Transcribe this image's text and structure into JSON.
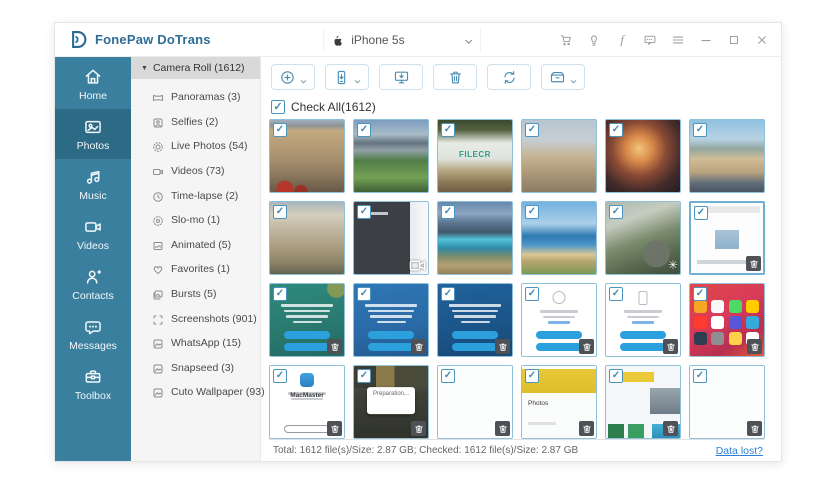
{
  "titlebar": {
    "logo_text": "FonePaw DoTrans",
    "device_name": "iPhone 5s",
    "window_icons": [
      "cart",
      "bulb",
      "facebook",
      "feedback",
      "menu",
      "minimize",
      "maximize",
      "close"
    ]
  },
  "sidebar": {
    "items": [
      {
        "id": "home",
        "label": "Home",
        "icon": "home",
        "active": false
      },
      {
        "id": "photos",
        "label": "Photos",
        "icon": "photos",
        "active": true
      },
      {
        "id": "music",
        "label": "Music",
        "icon": "music",
        "active": false
      },
      {
        "id": "videos",
        "label": "Videos",
        "icon": "videocam",
        "active": false
      },
      {
        "id": "contacts",
        "label": "Contacts",
        "icon": "contacts",
        "active": false
      },
      {
        "id": "messages",
        "label": "Messages",
        "icon": "messages",
        "active": false
      },
      {
        "id": "toolbox",
        "label": "Toolbox",
        "icon": "toolbox",
        "active": false
      }
    ]
  },
  "categories": {
    "header": "Camera Roll (1612)",
    "items": [
      {
        "id": "panoramas",
        "icon": "panorama",
        "label": "Panoramas (3)"
      },
      {
        "id": "selfies",
        "icon": "selfie",
        "label": "Selfies (2)"
      },
      {
        "id": "live-photos",
        "icon": "live",
        "label": "Live Photos (54)"
      },
      {
        "id": "videos",
        "icon": "video",
        "label": "Videos (73)"
      },
      {
        "id": "time-lapse",
        "icon": "clock",
        "label": "Time-lapse (2)"
      },
      {
        "id": "slo-mo",
        "icon": "slomo",
        "label": "Slo-mo (1)"
      },
      {
        "id": "animated",
        "icon": "animated",
        "label": "Animated (5)"
      },
      {
        "id": "favorites",
        "icon": "heart",
        "label": "Favorites (1)"
      },
      {
        "id": "bursts",
        "icon": "burst",
        "label": "Bursts (5)"
      },
      {
        "id": "screenshots",
        "icon": "screenshot",
        "label": "Screenshots (901)"
      },
      {
        "id": "whatsapp",
        "icon": "image",
        "label": "WhatsApp (15)"
      },
      {
        "id": "snapseed",
        "icon": "image",
        "label": "Snapseed (3)"
      },
      {
        "id": "cuto-wallpaper",
        "icon": "image",
        "label": "Cuto Wallpaper (93)"
      }
    ]
  },
  "toolbar": {
    "buttons": [
      {
        "id": "add",
        "icon": "add",
        "chevron": true
      },
      {
        "id": "export-to-device",
        "icon": "export-device",
        "chevron": true
      },
      {
        "id": "export-to-pc",
        "icon": "export-pc",
        "chevron": false
      },
      {
        "id": "delete",
        "icon": "trash",
        "chevron": false
      },
      {
        "id": "refresh",
        "icon": "refresh",
        "chevron": false
      },
      {
        "id": "more-tools",
        "icon": "tools",
        "chevron": true
      }
    ],
    "check_all_label": "Check All(1612)"
  },
  "grid": {
    "tiles": [
      {
        "name": "european-building",
        "bg": "radial-gradient(circle at 20% 96%, rgba(185,52,40,.95) 0 8px, rgba(185,52,40,0) 9px), radial-gradient(circle at 42% 99%, rgba(160,40,30,.85) 0 6px, rgba(160,40,30,0) 7px), linear-gradient(180deg,#9fb1bb 0%,#8e9496 8%,#c3aa80 15%,#ab9370 50%,#8d7a5e 76%,#665747 100%)"
      },
      {
        "name": "mountain-valley",
        "bg": "linear-gradient(180deg,#7d9cc0 0%,#a9bcc8 20%,#647480 32%,#93a0a8 42%,#517d48 56%,#74a055 80%,#3f5f36 100%)"
      },
      {
        "name": "waterfall",
        "bg": "linear-gradient(180deg,#3a4930 0%,#536341 14%,#e9ece6 32%,#dde2dc 54%,#b5a883 70%,#8d7a57 86%,#6f5d42 100%)",
        "watermark": {
          "text": "FILECR",
          "color": "#2e9a88"
        }
      },
      {
        "name": "city-panorama",
        "bg": "linear-gradient(180deg,#b7c5d0 0%,#c6ced3 28%,#c5b596 50%,#ad9a7a 72%,#8d7c63 100%)"
      },
      {
        "name": "ferris-wheel-night",
        "bg": "radial-gradient(circle at 45% 40%, #f2c57a 0%, #d98a4a 22%, #8a4a35 45%, #422b2a 72%, #241c20 100%)"
      },
      {
        "name": "hill-basilica",
        "bg": "linear-gradient(180deg,#8fc0e0 0%,#b7d3e4 26%,#93a6a0 40%,#cfbd97 54%,#bba480 72%,#5f6c79 88%,#4a5560 100%)"
      },
      {
        "name": "palace-facade",
        "bg": "linear-gradient(180deg,#a9b6bc 0%,#d5cfbd 18%,#bdb29a 42%,#a59a7a 66%,#8a8266 85%,#636250 100%)"
      },
      {
        "name": "dark-video",
        "bg": "linear-gradient(rgba(210,214,219,.9),rgba(210,214,219,.9)) 8px 10px/26px 3px no-repeat, linear-gradient(90deg,#3c4045 0%,#3c4045 76%,#e9ebee 76%,#f8f9fa 100%)",
        "badge": "video"
      },
      {
        "name": "mountain-lake",
        "bg": "linear-gradient(180deg,#6888ab 0%,#8ba6c2 16%,#57738c 30%,#41586b 42%,#52c2d8 52%,#2f8aa6 64%,#7e8c6c 76%,#b5a172 88%,#93815c 100%)"
      },
      {
        "name": "beach-coast",
        "bg": "linear-gradient(180deg,#74b0de 0%,#abd0ea 30%,#2f7ab3 47%,#4f97c9 60%,#dbc795 73%,#b5a36f 83%,#7a9a55 100%)"
      },
      {
        "name": "grass-slomo",
        "bg": "radial-gradient(circle at 68% 72%, rgba(110,116,106,.9) 0 13px, rgba(110,116,106,0) 14px), linear-gradient(160deg,#adb8ae 0%,#c5cdc1 26%,#7a8a6c 52%,#57684d 76%,#404e3a 100%)",
        "badge": "slomo"
      },
      {
        "name": "document-preview",
        "bg": "linear-gradient(#e6e8ea,#e6e8ea) 50% 3px/92% 7px no-repeat, linear-gradient(#a9c3d8,#8fb3cc) 50% 52%/24px 19px no-repeat, linear-gradient(#cdd6db,#cdd6db) 50% 87%/82% 4px no-repeat, #fdfdfe",
        "badge": "trash",
        "selected": true
      },
      {
        "name": "promo-teal",
        "bg": "radial-gradient(circle at 90% 6%, rgba(205,170,60,.55) 0 9px, rgba(205,170,60,0) 10px), linear-gradient(170deg,#2f8a7e 0%,#2a7a70 55%,#226a62 100%)",
        "lines": "light",
        "pills": {
          "count": 2,
          "style": "solid"
        },
        "badge": "trash"
      },
      {
        "name": "promo-blue",
        "bg": "linear-gradient(170deg,#2f77b5 0%,#2a6aa6 60%,#235a90 100%)",
        "lines": "light",
        "pills": {
          "count": 2,
          "style": "solid"
        },
        "badge": "trash"
      },
      {
        "name": "promo-navy",
        "bg": "linear-gradient(170deg,#20639c 0%,#1b5488 60%,#174878 100%)",
        "lines": "light",
        "pills": {
          "count": 2,
          "style": "solid"
        },
        "badge": "trash"
      },
      {
        "name": "promo-light-circle",
        "bg": "#ffffff",
        "glyph": "circle",
        "lines": "dark",
        "link_line": true,
        "pills": {
          "count": 2,
          "style": "solid"
        },
        "badge": "trash"
      },
      {
        "name": "promo-light-phone",
        "bg": "#ffffff",
        "glyph": "phone",
        "lines": "dark",
        "link_line": true,
        "pills": {
          "count": 2,
          "style": "solid"
        },
        "badge": "trash"
      },
      {
        "name": "ios-home-screen",
        "bg": "linear-gradient(150deg,#e04848 0%,#d83a5a 45%,#b82f4f 75%,#e85a3a 100%)",
        "apps": [
          "#f5a623",
          "#f8f8f8",
          "#4cd964",
          "#ffcc00",
          "#ff3b30",
          "#ffffff",
          "#5856d6",
          "#34aadc",
          "#2c3e50",
          "#8e8e93",
          "#ffd24a",
          "#ffffff"
        ],
        "badge": "trash"
      },
      {
        "name": "promo-macmaster",
        "bg": "#ffffff",
        "glyph": "appblue",
        "label": {
          "text": "MacMaster",
          "pos": "center"
        },
        "lines": "dark",
        "pills": {
          "count": 1,
          "style": "outline"
        },
        "badge": "trash"
      },
      {
        "name": "photo-dialog",
        "bg": "linear-gradient(90deg,#3a3d33 0 30%, #8a7a4a 30% 55%, #4a4a3a 55% 100%) 0 0/100% 22px no-repeat, linear-gradient(180deg,#55584a 0%,#3e4136 40%,#30332a 100%)",
        "dialog": "Préparation...",
        "badge": "trash"
      },
      {
        "name": "blank-screenshot-1",
        "bg": "#fcfdfd",
        "badge": "trash"
      },
      {
        "name": "yellow-photos",
        "bg": "linear-gradient(#ffffff,#ffffff) 0 0/100% 3px no-repeat, linear-gradient(#e9c937,#dfbe2e) 0 3px/100% 24px no-repeat, linear-gradient(#e0e0e0,#e0e0e0) 6px 56px/28px 3px no-repeat, #fafbfb",
        "label": {
          "text": "Photos",
          "pos": "left"
        },
        "badge": "trash"
      },
      {
        "name": "collage-screenshot",
        "bg": "linear-gradient(#e9c937,#e9c937) 4px 6px/44px 10px no-repeat, linear-gradient(#98a5ad,#707d88) 100% 22px/30px 26px no-repeat, linear-gradient(#2e7d4f,#2e7d4f) 2px 58px/16px 14px no-repeat, linear-gradient(#3a9d62,#3a9d62) 22px 58px/16px 14px no-repeat, linear-gradient(180deg,#44b0d5,#2a8ab5) 46px 58px/28px 16px no-repeat, #f5f6f7",
        "badge": "trash"
      },
      {
        "name": "blank-screenshot-2",
        "bg": "#fcfdfd",
        "badge": "trash"
      }
    ]
  },
  "statusbar": {
    "summary": "Total: 1612 file(s)/Size: 2.87 GB; Checked: 1612 file(s)/Size: 2.87 GB",
    "link": "Data lost?"
  },
  "colors": {
    "accent_blue": "#2b6a94",
    "nav_teal": "#3a7f9e",
    "nav_active": "#2d6a85",
    "icon_blue": "#4a8cb4",
    "check_blue": "#3f89b5",
    "link_blue": "#2a7fd4"
  }
}
